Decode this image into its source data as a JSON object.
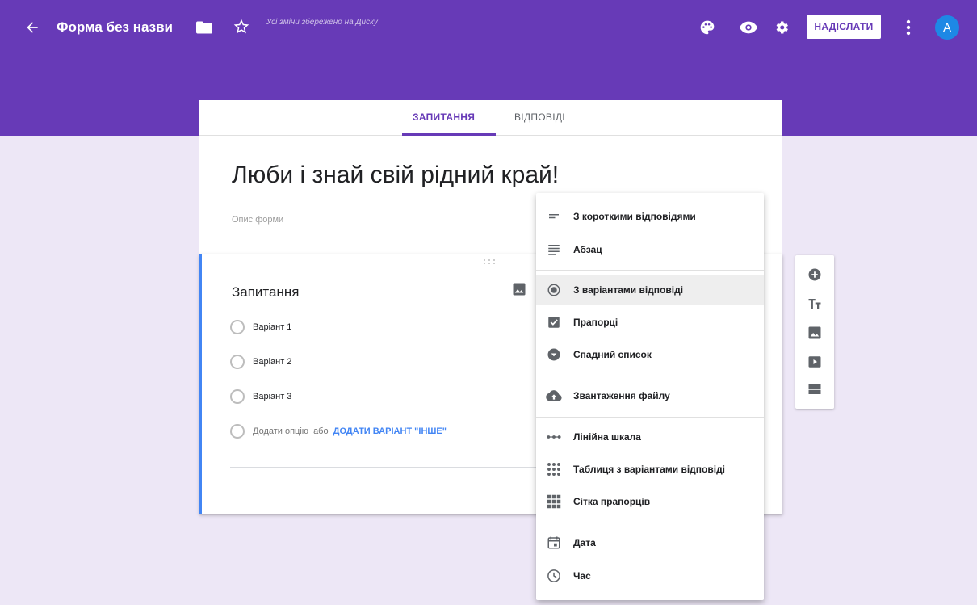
{
  "header": {
    "form_title": "Форма без назви",
    "save_status": "Усі зміни збережено на Диску",
    "send_label": "НАДІСЛАТИ",
    "avatar_letter": "A"
  },
  "tabs": [
    {
      "label": "ЗАПИТАННЯ",
      "active": true
    },
    {
      "label": "ВІДПОВІДІ",
      "active": false
    }
  ],
  "form": {
    "heading": "Люби і знай свій рідний край!",
    "description_placeholder": "Опис форми"
  },
  "question": {
    "title": "Запитання",
    "options": [
      "Варіант 1",
      "Варіант 2",
      "Варіант 3"
    ],
    "add_option": "Додати опцію",
    "or": "або",
    "add_other": "ДОДАТИ ВАРІАНТ \"ІНШЕ\""
  },
  "menu": {
    "items": [
      {
        "label": "З короткими відповідями",
        "icon": "short-text-icon"
      },
      {
        "label": "Абзац",
        "icon": "paragraph-icon"
      },
      {
        "label": "З варіантами відповіді",
        "icon": "radio-icon",
        "active": true
      },
      {
        "label": "Прапорці",
        "icon": "checkbox-icon"
      },
      {
        "label": "Спадний список",
        "icon": "dropdown-icon"
      },
      {
        "label": "Звантаження файлу",
        "icon": "upload-icon"
      },
      {
        "label": "Лінійна шкала",
        "icon": "linear-scale-icon"
      },
      {
        "label": "Таблиця з варіантами відповіді",
        "icon": "grid-dots-icon"
      },
      {
        "label": "Сітка прапорців",
        "icon": "grid-squares-icon"
      },
      {
        "label": "Дата",
        "icon": "calendar-icon"
      },
      {
        "label": "Час",
        "icon": "clock-icon"
      }
    ]
  },
  "colors": {
    "primary": "#673ab7",
    "background": "#ede7f6",
    "accent": "#4285f4"
  }
}
